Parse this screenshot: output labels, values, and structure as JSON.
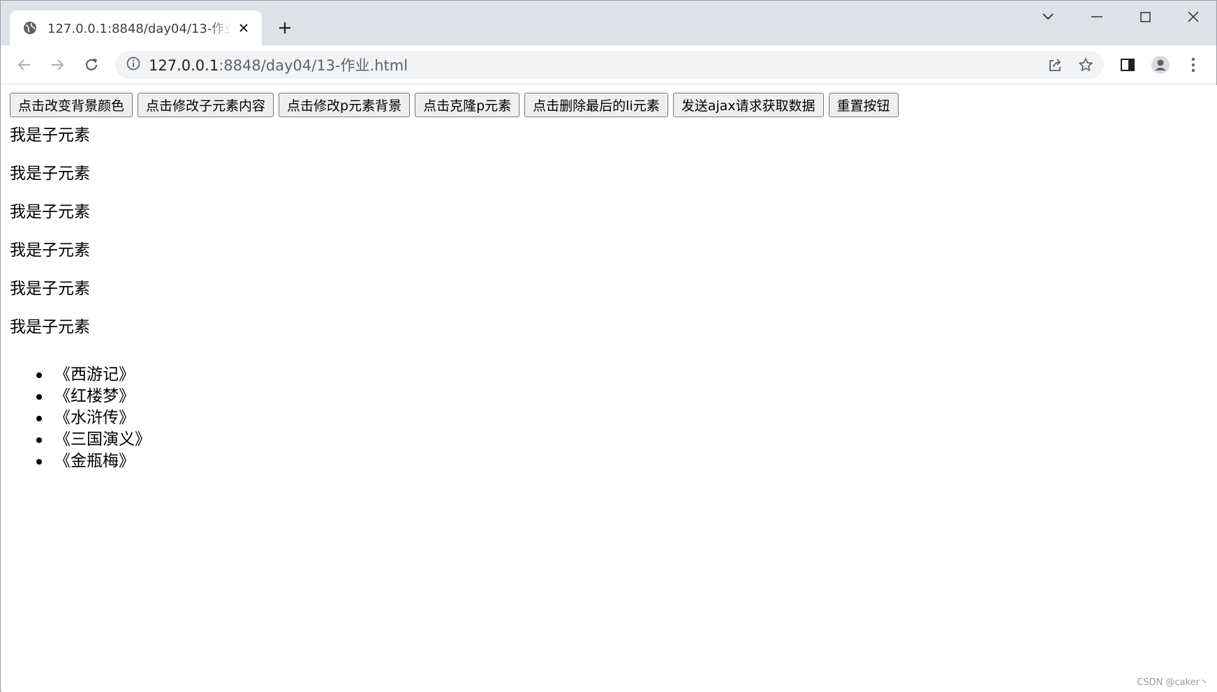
{
  "browser": {
    "tab_title": "127.0.0.1:8848/day04/13-作业.html",
    "url_host": "127.0.0.1",
    "url_rest": ":8848/day04/13-作业.html"
  },
  "page": {
    "buttons": [
      "点击改变背景颜色",
      "点击修改子元素内容",
      "点击修改p元素背景",
      "点击克隆p元素",
      "点击删除最后的li元素",
      "发送ajax请求获取数据",
      "重置按钮"
    ],
    "paragraphs": [
      "我是子元素",
      "我是子元素",
      "我是子元素",
      "我是子元素",
      "我是子元素",
      "我是子元素"
    ],
    "list_items": [
      "《西游记》",
      "《红楼梦》",
      "《水浒传》",
      "《三国演义》",
      "《金瓶梅》"
    ]
  },
  "watermark": "CSDN @caker丶",
  "icons": {
    "favicon": "globe-icon",
    "close": "close-icon",
    "new_tab": "plus-icon",
    "back": "back-arrow-icon",
    "forward": "forward-arrow-icon",
    "reload": "reload-icon",
    "site_info": "info-icon",
    "share": "share-icon",
    "bookmark": "star-icon",
    "side_panel": "side-panel-icon",
    "profile": "profile-icon",
    "menu": "kebab-menu-icon"
  }
}
